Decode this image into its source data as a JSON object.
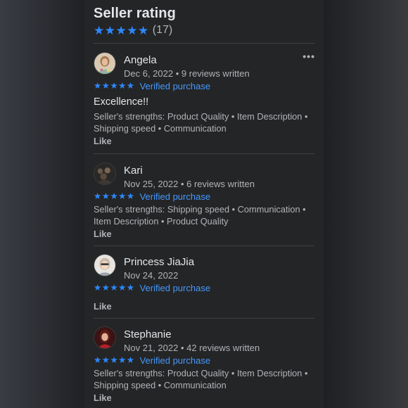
{
  "seller_rating": {
    "title": "Seller rating",
    "stars": 5,
    "count_label": "(17)"
  },
  "reviews": [
    {
      "name": "Angela",
      "date": "Dec 6, 2022",
      "reviews_written": "9 reviews written",
      "stars": 5,
      "verified_label": "Verified purchase",
      "text": "Excellence!!",
      "strengths": "Seller's strengths: Product Quality • Item Description • Shipping speed • Communication",
      "like_label": "Like"
    },
    {
      "name": "Kari",
      "date": "Nov 25, 2022",
      "reviews_written": "6 reviews written",
      "stars": 5,
      "verified_label": "Verified purchase",
      "strengths": "Seller's strengths: Shipping speed • Communication • Item Description • Product Quality",
      "like_label": "Like"
    },
    {
      "name": "Princess JiaJia",
      "date": "Nov 24, 2022",
      "stars": 5,
      "verified_label": "Verified purchase",
      "like_label": "Like"
    },
    {
      "name": "Stephanie",
      "date": "Nov 21, 2022",
      "reviews_written": "42 reviews written",
      "stars": 5,
      "verified_label": "Verified purchase",
      "strengths": "Seller's strengths: Product Quality • Item Description • Shipping speed • Communication",
      "like_label": "Like"
    }
  ],
  "icons": {
    "star": "star-icon",
    "more": "more-options-icon"
  },
  "colors": {
    "accent": "#2d88ff",
    "panel_bg": "#242526",
    "text_primary": "#e4e6eb",
    "text_secondary": "#b0b3b8"
  }
}
